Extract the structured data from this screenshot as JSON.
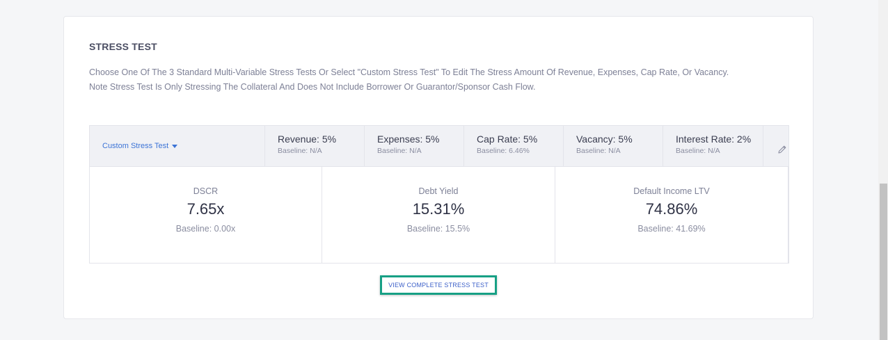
{
  "section": {
    "title": "STRESS TEST",
    "description_line1": "Choose One Of The 3 Standard Multi-Variable Stress Tests Or Select \"Custom Stress Test\" To Edit The Stress Amount Of Revenue, Expenses, Cap Rate, Or Vacancy.",
    "description_line2": "Note Stress Test Is Only Stressing The Collateral And Does Not Include Borrower Or Guarantor/Sponsor Cash Flow."
  },
  "selector": {
    "selected": "Custom Stress Test",
    "icon": "caret-down-icon"
  },
  "parameters": [
    {
      "label": "Revenue: 5%",
      "baseline": "Baseline: N/A"
    },
    {
      "label": "Expenses: 5%",
      "baseline": "Baseline: N/A"
    },
    {
      "label": "Cap Rate: 5%",
      "baseline": "Baseline: 6.46%"
    },
    {
      "label": "Vacancy: 5%",
      "baseline": "Baseline: N/A"
    },
    {
      "label": "Interest Rate: 2%",
      "baseline": "Baseline: N/A"
    }
  ],
  "edit_icon": "pencil-icon",
  "metrics": [
    {
      "label": "DSCR",
      "value": "7.65x",
      "baseline": "Baseline: 0.00x"
    },
    {
      "label": "Debt Yield",
      "value": "15.31%",
      "baseline": "Baseline: 15.5%"
    },
    {
      "label": "Default Income LTV",
      "value": "74.86%",
      "baseline": "Baseline: 41.69%"
    }
  ],
  "view_button": "VIEW COMPLETE STRESS TEST",
  "colors": {
    "accent": "#3b73d6",
    "button_border": "#17a085",
    "header_bg": "#f0f1f5"
  }
}
